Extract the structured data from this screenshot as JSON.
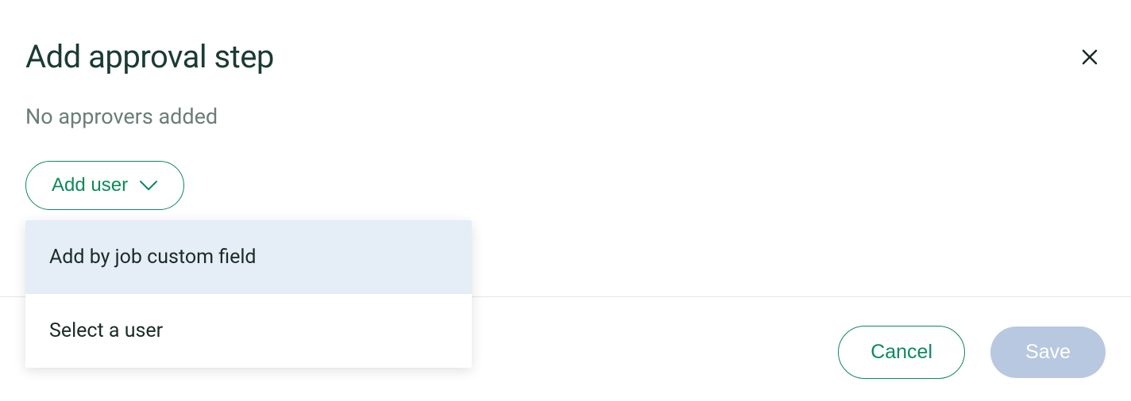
{
  "header": {
    "title": "Add approval step"
  },
  "subtitle": "No approvers added",
  "add_user": {
    "label": "Add user",
    "options": [
      {
        "label": "Add by job custom field",
        "highlighted": true
      },
      {
        "label": "Select a user",
        "highlighted": false
      }
    ]
  },
  "footer": {
    "cancel_label": "Cancel",
    "save_label": "Save"
  }
}
